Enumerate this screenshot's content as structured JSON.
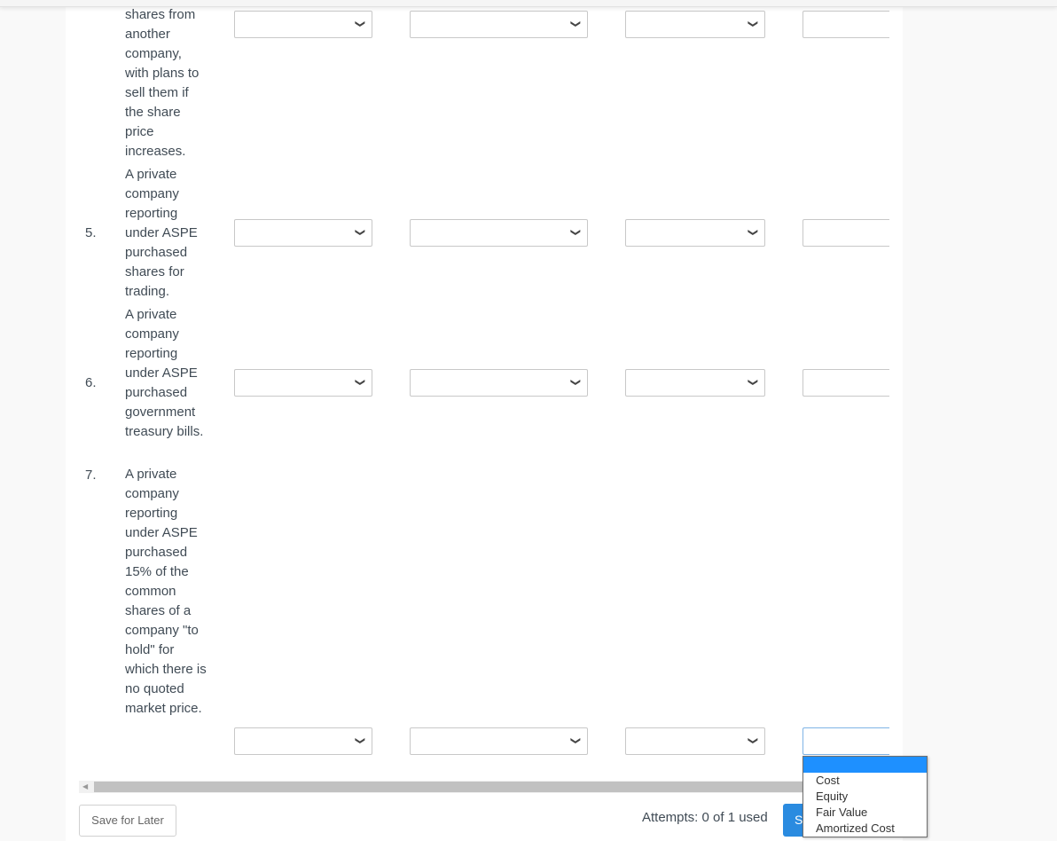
{
  "questions": [
    {
      "number": "",
      "text": "shares from another company, with plans to sell them if the share price increases."
    },
    {
      "number": "5.",
      "text": "A private company reporting under ASPE purchased shares for trading."
    },
    {
      "number": "6.",
      "text": "A private company reporting under ASPE purchased government treasury bills."
    },
    {
      "number": "7.",
      "text": "A private company reporting under ASPE purchased 15% of the common shares of a company \"to hold\" for which there is no quoted market price."
    }
  ],
  "select_values": [
    "",
    "",
    "",
    ""
  ],
  "open_dropdown": {
    "options": [
      "",
      "Cost",
      "Equity",
      "Fair Value",
      "Amortized Cost"
    ],
    "highlighted_index": 0
  },
  "footer": {
    "save_label": "Save for Later",
    "attempts_label": "Attempts: 0 of 1 used",
    "submit_label": "Submit Answer"
  },
  "colors": {
    "accent": "#2a8be0",
    "highlight": "#1e90ff"
  }
}
